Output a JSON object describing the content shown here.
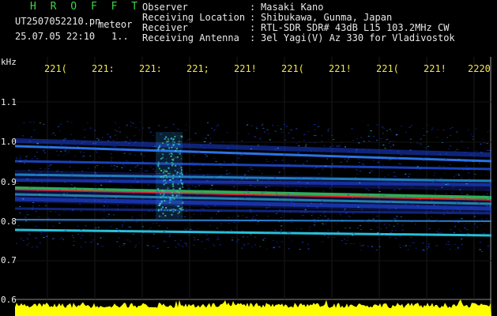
{
  "header": {
    "brand": "H R O F F T",
    "file_name": "UT2507052210.pn",
    "file_suffix": "meteor",
    "datetime": "25.07.05 22:10",
    "datetime_tail": "1..",
    "info": [
      {
        "key": "Observer",
        "sep": ":",
        "value": "Masaki Kano"
      },
      {
        "key": "Receiving Location",
        "sep": ":",
        "value": "Shibukawa, Gunma, Japan"
      },
      {
        "key": "Receiver",
        "sep": ":",
        "value": "RTL-SDR SDR# 43dB L15 103.2MHz CW"
      },
      {
        "key": "Receiving Antenna",
        "sep": ":",
        "value": "3el Yagi(V) Az 330 for Vladivostok"
      }
    ]
  },
  "axes": {
    "y_unit": "kHz",
    "y_ticks": [
      "1.1",
      "1.0",
      "0.9",
      "0.8",
      "0.7",
      "0.6"
    ],
    "x_ticks": [
      "221(",
      "221:",
      "221:",
      "221;",
      "221!",
      "221(",
      "221!",
      "221(",
      "221!",
      "2220"
    ]
  },
  "colors": {
    "background": "#000000",
    "brand": "#3fd34a",
    "header_text": "#e8e8e8",
    "time_labels": "#f2e64a",
    "noise_floor": "#ffff00",
    "echo_red": "#ff2a2a"
  }
}
